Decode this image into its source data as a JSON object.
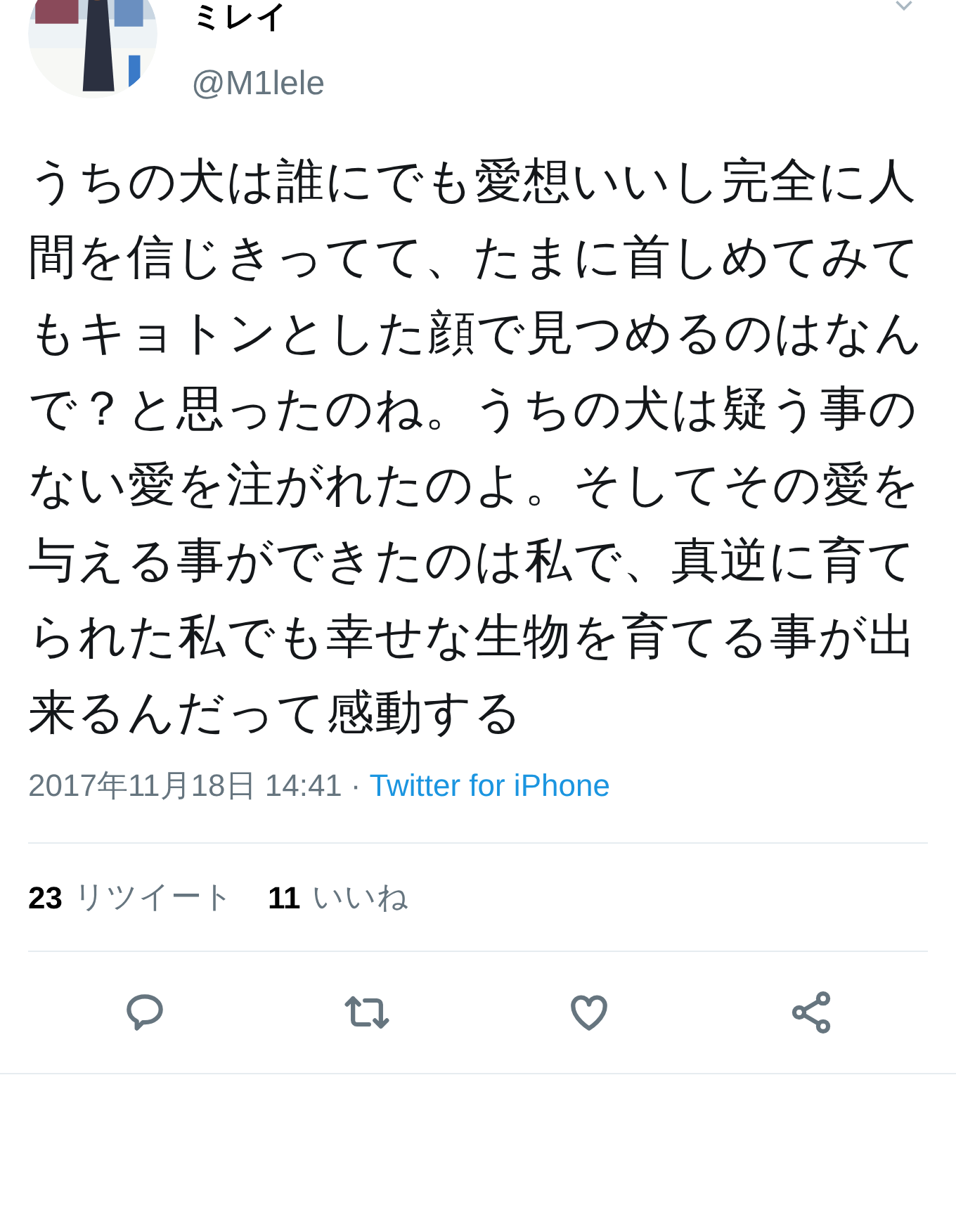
{
  "author": {
    "name": "ミレイ",
    "handle": "@M1lele"
  },
  "tweet": {
    "text": "うちの犬は誰にでも愛想いいし完全に人間を信じきってて、たまに首しめてみてもキョトンとした顔で見つめるのはなんで？と思ったのね。うちの犬は疑う事のない愛を注がれたのよ。そしてその愛を与える事ができたのは私で、真逆に育てられた私でも幸せな生物を育てる事が出来るんだって感動する",
    "timestamp": "2017年11月18日 14:41",
    "separator": "·",
    "source": "Twitter for iPhone"
  },
  "stats": [
    {
      "count": "23",
      "label": "リツイート"
    },
    {
      "count": "11",
      "label": "いいね"
    }
  ],
  "actions": [
    {
      "kind": "reply"
    },
    {
      "kind": "retweet"
    },
    {
      "kind": "like"
    },
    {
      "kind": "share"
    }
  ]
}
